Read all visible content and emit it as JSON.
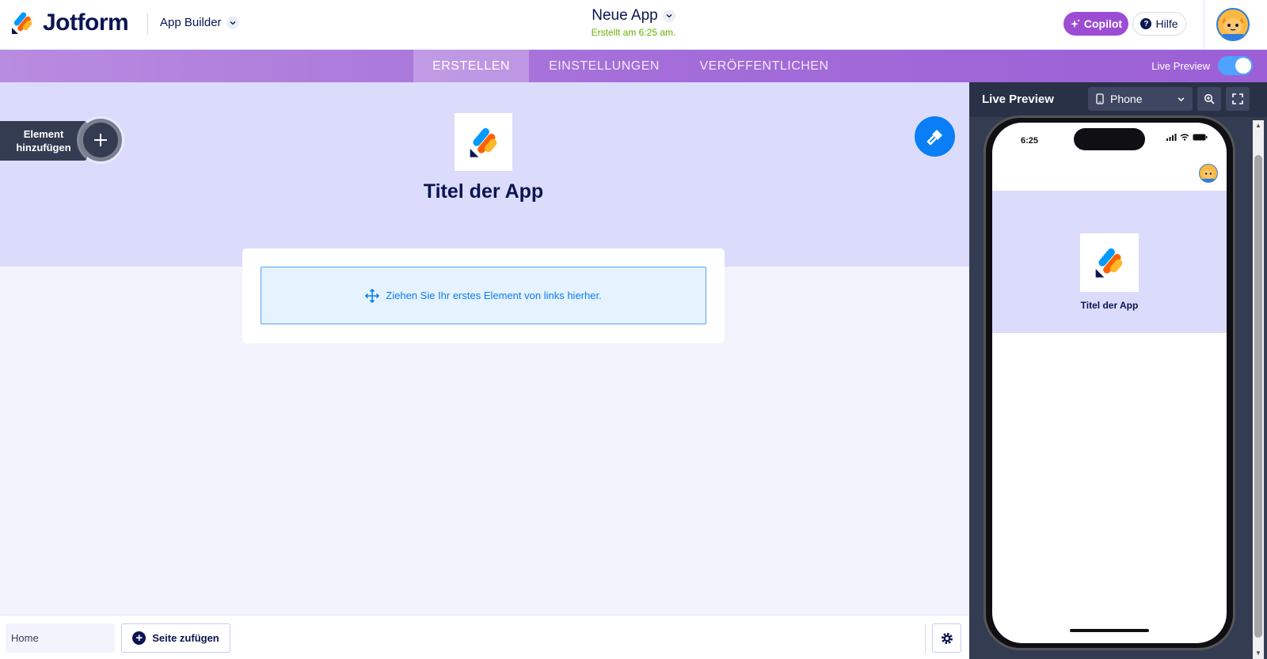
{
  "header": {
    "logo_text": "Jotform",
    "product_label": "App Builder",
    "app_name": "Neue App",
    "app_status": "Erstellt am 6:25 am.",
    "copilot_label": "Copilot",
    "help_label": "Hilfe"
  },
  "tabs": [
    {
      "label": "ERSTELLEN",
      "active": true
    },
    {
      "label": "EINSTELLUNGEN",
      "active": false
    },
    {
      "label": "VERÖFFENTLICHEN",
      "active": false
    }
  ],
  "live_preview_toggle": {
    "label": "Live Preview",
    "on": true
  },
  "canvas": {
    "add_element_label": "Element hinzufügen",
    "app_title": "Titel der App",
    "drop_hint": "Ziehen Sie Ihr erstes Element von links hierher."
  },
  "footer": {
    "page_name": "Home",
    "add_page_label": "Seite zufügen"
  },
  "preview_panel": {
    "title": "Live Preview",
    "device": "Phone",
    "phone_time": "6:25",
    "phone_app_title": "Titel der App"
  },
  "colors": {
    "brand_navy": "#0a1551",
    "copilot_purple": "#9c4dd3",
    "accent_blue": "#0a7ef5",
    "hero_lavender": "#dbdcfb",
    "status_green": "#64b200"
  },
  "icons": [
    "jotform-logo-icon",
    "chevron-down-icon",
    "sparkle-icon",
    "help-icon",
    "avatar",
    "plus-icon",
    "paint-roller-icon",
    "move-arrows-icon",
    "gear-icon",
    "phone-icon",
    "zoom-icon",
    "fullscreen-icon",
    "signal-icon",
    "wifi-icon",
    "battery-icon"
  ]
}
